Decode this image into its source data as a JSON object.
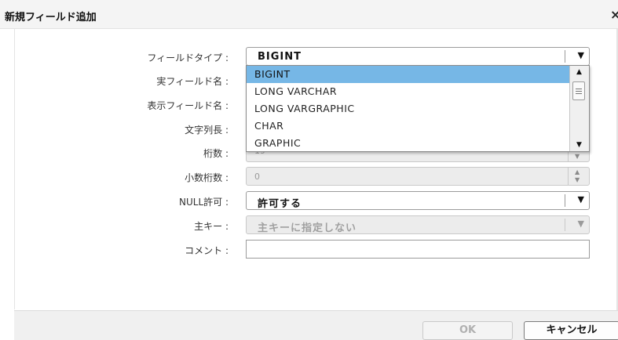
{
  "dialog": {
    "title": "新規フィールド追加",
    "close_glyph": "×"
  },
  "form": {
    "field_type": {
      "label": "フィールドタイプ :",
      "value": "BIGINT"
    },
    "physical_name": {
      "label": "実フィールド名 :"
    },
    "display_name": {
      "label": "表示フィールド名 :"
    },
    "length": {
      "label": "文字列長 :"
    },
    "digits": {
      "label": "桁数 :",
      "value": "19"
    },
    "decimals": {
      "label": "小数桁数 :",
      "value": "0"
    },
    "nullable": {
      "label": "NULL許可 :",
      "value": "許可する"
    },
    "primary_key": {
      "label": "主キー :",
      "value": "主キーに指定しない"
    },
    "comment": {
      "label": "コメント :"
    }
  },
  "dropdown": {
    "options": [
      "BIGINT",
      "LONG VARCHAR",
      "LONG VARGRAPHIC",
      "CHAR",
      "GRAPHIC"
    ],
    "selected": "BIGINT"
  },
  "footer": {
    "ok_label": "OK",
    "cancel_label": "キャンセル"
  },
  "icons": {
    "select_arrow": "chevron-down-icon",
    "spin_up": "spin-up-icon",
    "spin_down": "spin-down-icon"
  },
  "colors": {
    "selected_option": "#76b7e6"
  }
}
